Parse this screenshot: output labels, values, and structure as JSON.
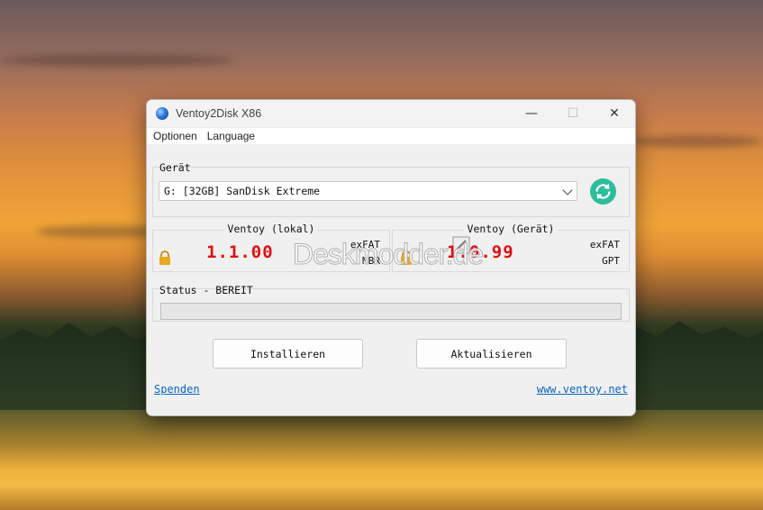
{
  "window": {
    "title": "Ventoy2Disk  X86",
    "controls": {
      "minimize": "—",
      "maximize": "☐",
      "close": "✕"
    }
  },
  "menu": {
    "items": [
      "Optionen",
      "Language"
    ]
  },
  "device": {
    "label": "Gerät",
    "selected": "G: [32GB] SanDisk Extreme"
  },
  "versions": {
    "local": {
      "title": "Ventoy (lokal)",
      "version": "1.1.00",
      "fs": "exFAT",
      "partition": "MBR"
    },
    "device": {
      "title": "Ventoy (Gerät)",
      "version": "1.0.99",
      "fs": "exFAT",
      "partition": "GPT"
    }
  },
  "watermark": "Deskmodder.de",
  "status": {
    "label": "Status - BEREIT",
    "progress": 0
  },
  "buttons": {
    "install": "Installieren",
    "update": "Aktualisieren"
  },
  "links": {
    "donate": "Spenden",
    "website": "www.ventoy.net"
  },
  "colors": {
    "version_red": "#e01010",
    "refresh_teal": "#2dbd9c",
    "link_blue": "#0a66c2"
  }
}
